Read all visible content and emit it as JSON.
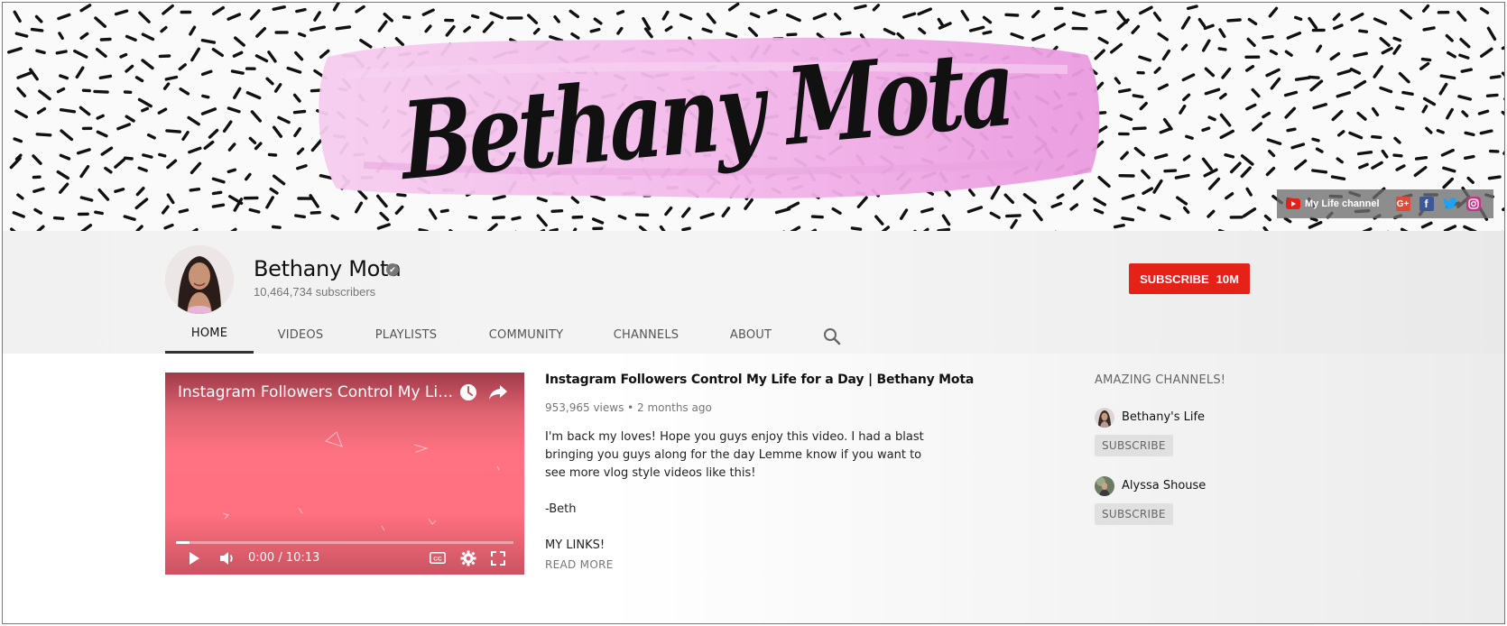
{
  "banner": {
    "title": "Bethany Mota",
    "links": {
      "label": "My Life channel",
      "icons": [
        "youtube-icon",
        "google-plus-icon",
        "facebook-icon",
        "twitter-icon",
        "instagram-icon"
      ]
    }
  },
  "channel": {
    "name": "Bethany Mota",
    "subscribers": "10,464,734 subscribers",
    "subscribe_label": "SUBSCRIBE",
    "subscribe_count": "10M"
  },
  "tabs": [
    {
      "label": "HOME",
      "active": true
    },
    {
      "label": "VIDEOS"
    },
    {
      "label": "PLAYLISTS"
    },
    {
      "label": "COMMUNITY"
    },
    {
      "label": "CHANNELS"
    },
    {
      "label": "ABOUT"
    }
  ],
  "video": {
    "overlay_title": "Instagram Followers Control My Life fo...",
    "time": "0:00 / 10:13",
    "progress": 0.04
  },
  "info": {
    "title": "Instagram Followers Control My Life for a Day | Bethany Mota",
    "meta": "953,965 views • 2 months ago",
    "desc": [
      "I'm back my loves! Hope you guys enjoy this video. I had a blast",
      "bringing you guys along for the day Lemme know if you want to",
      "see more vlog style videos like this!",
      "",
      "-Beth",
      "",
      "MY LINKS!"
    ],
    "read_more": "READ MORE"
  },
  "featured": {
    "heading": "AMAZING CHANNELS!",
    "channels": [
      {
        "name": "Bethany's Life",
        "subscribe": "SUBSCRIBE"
      },
      {
        "name": "Alyssa Shouse",
        "subscribe": "SUBSCRIBE"
      }
    ]
  },
  "colors": {
    "accent": "#e62117",
    "brush": "#f0b8e6"
  }
}
